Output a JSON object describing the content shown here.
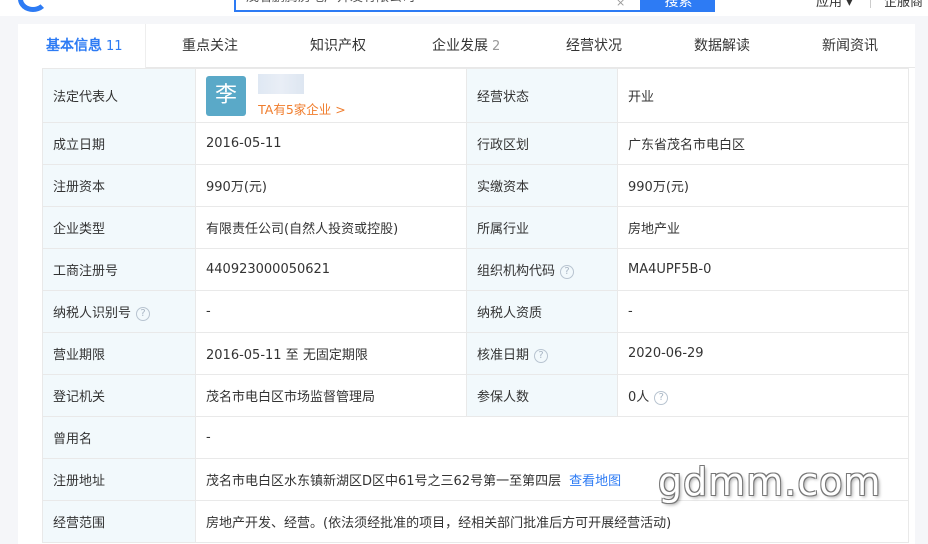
{
  "header": {
    "search_value": "茂名鹏腾房地产开发有限公司",
    "clear_symbol": "×",
    "search_button": "搜索",
    "links": [
      "应用 ▾",
      "企服商"
    ]
  },
  "tabs": [
    {
      "label": "基本信息",
      "count": "11"
    },
    {
      "label": "重点关注",
      "count": ""
    },
    {
      "label": "知识产权",
      "count": ""
    },
    {
      "label": "企业发展",
      "count": "2"
    },
    {
      "label": "经营状况",
      "count": ""
    },
    {
      "label": "数据解读",
      "count": ""
    },
    {
      "label": "新闻资讯",
      "count": ""
    }
  ],
  "info": {
    "legal_rep_label": "法定代表人",
    "avatar_char": "李",
    "ta_link": "TA有5家企业 >",
    "status_label": "经营状态",
    "status_value": "开业",
    "found_date_label": "成立日期",
    "found_date_value": "2016-05-11",
    "region_label": "行政区划",
    "region_value": "广东省茂名市电白区",
    "reg_capital_label": "注册资本",
    "reg_capital_value": "990万(元)",
    "paid_capital_label": "实缴资本",
    "paid_capital_value": "990万(元)",
    "type_label": "企业类型",
    "type_value": "有限责任公司(自然人投资或控股)",
    "industry_label": "所属行业",
    "industry_value": "房地产业",
    "reg_no_label": "工商注册号",
    "reg_no_value": "440923000050621",
    "org_code_label": "组织机构代码",
    "org_code_value": "MA4UPF5B-0",
    "taxpayer_id_label": "纳税人识别号",
    "taxpayer_id_value": "-",
    "taxpayer_qual_label": "纳税人资质",
    "taxpayer_qual_value": "-",
    "term_label": "营业期限",
    "term_value": "2016-05-11 至 无固定期限",
    "approve_date_label": "核准日期",
    "approve_date_value": "2020-06-29",
    "authority_label": "登记机关",
    "authority_value": "茂名市电白区市场监督管理局",
    "insured_label": "参保人数",
    "insured_value": "0人",
    "former_name_label": "曾用名",
    "former_name_value": "-",
    "address_label": "注册地址",
    "address_value": "茂名市电白区水东镇新湖区D区中61号之三62号第一至第四层",
    "map_link": "查看地图",
    "scope_label": "经营范围",
    "scope_value": "房地产开发、经营。(依法须经批准的项目，经相关部门批准后方可开展经营活动)",
    "help_symbol": "?"
  },
  "watermark": "gdmm.com",
  "colors": {
    "accent": "#2d7bf4",
    "label_bg": "#f2f9fc",
    "orange_link": "#f07d2d"
  }
}
